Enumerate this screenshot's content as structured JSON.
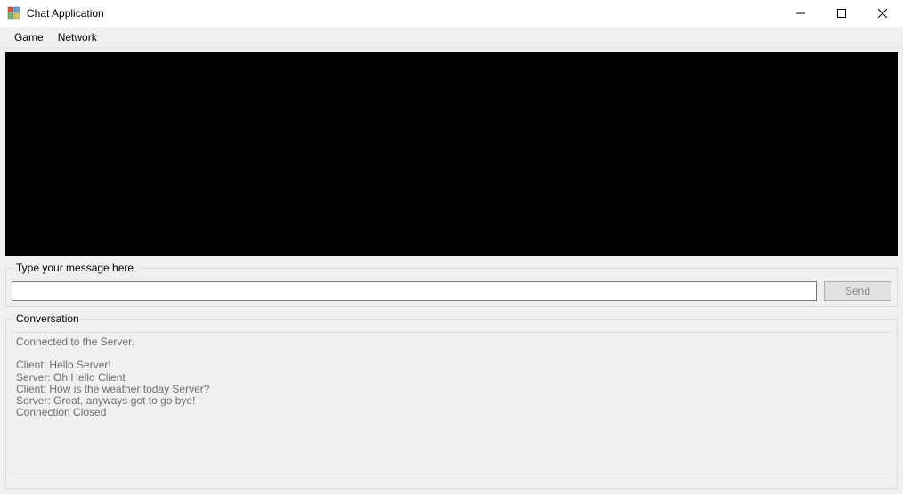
{
  "window": {
    "title": "Chat Application"
  },
  "menu": {
    "items": [
      "Game",
      "Network"
    ]
  },
  "input_group": {
    "legend": "Type your message here.",
    "value": "",
    "send_label": "Send"
  },
  "conversation_group": {
    "legend": "Conversation",
    "lines": [
      "Connected to the Server.",
      "",
      "Client: Hello Server!",
      "Server: Oh Hello Client",
      "Client: How is the weather today Server?",
      "Server: Great, anyways got to go bye!",
      "Connection Closed"
    ]
  }
}
